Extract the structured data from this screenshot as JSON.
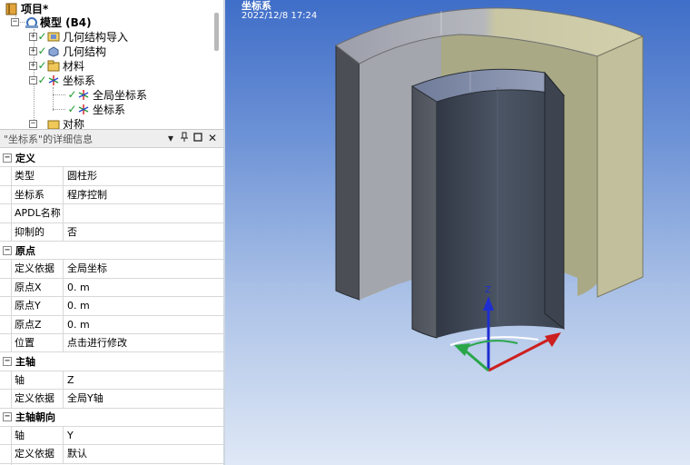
{
  "tree": {
    "items": [
      {
        "label": "项目*",
        "bold": true
      },
      {
        "label": "模型 (B4)",
        "bold": true
      },
      {
        "label": "几何结构导入"
      },
      {
        "label": "几何结构"
      },
      {
        "label": "材料"
      },
      {
        "label": "坐标系"
      },
      {
        "label": "全局坐标系"
      },
      {
        "label": "坐标系"
      },
      {
        "label": "对称"
      }
    ]
  },
  "details": {
    "title": "\"坐标系\"的详细信息",
    "pin_icon": "pin-icon",
    "sections": [
      {
        "name": "定义",
        "rows": [
          {
            "key": "类型",
            "value": "圆柱形"
          },
          {
            "key": "坐标系",
            "value": "程序控制"
          },
          {
            "key": "APDL名称",
            "value": ""
          },
          {
            "key": "抑制的",
            "value": "否"
          }
        ]
      },
      {
        "name": "原点",
        "rows": [
          {
            "key": "定义依据",
            "value": "全局坐标"
          },
          {
            "key": "原点X",
            "value": "0. m"
          },
          {
            "key": "原点Y",
            "value": "0. m"
          },
          {
            "key": "原点Z",
            "value": "0. m"
          },
          {
            "key": "位置",
            "value": "点击进行修改"
          }
        ]
      },
      {
        "name": "主轴",
        "rows": [
          {
            "key": "轴",
            "value": "Z"
          },
          {
            "key": "定义依据",
            "value": "全局Y轴"
          }
        ]
      },
      {
        "name": "主轴朝向",
        "rows": [
          {
            "key": "轴",
            "value": "Y"
          },
          {
            "key": "定义依据",
            "value": "默认"
          }
        ]
      }
    ]
  },
  "viewport": {
    "title": "坐标系",
    "date": "2022/12/8 17:24",
    "axis_label_z": "Z"
  },
  "colors": {
    "outer_top_left": "#9fa2ad",
    "outer_top_right": "#c9c7a2",
    "outer_face": "#a9a985",
    "outer_side": "#4b4e55",
    "inner_face": "#3f4651",
    "inner_top": "#7f8aa6",
    "axis_z": "#1f2ed1",
    "axis_x": "#cc1f1f",
    "axis_y": "#2aa64a"
  }
}
